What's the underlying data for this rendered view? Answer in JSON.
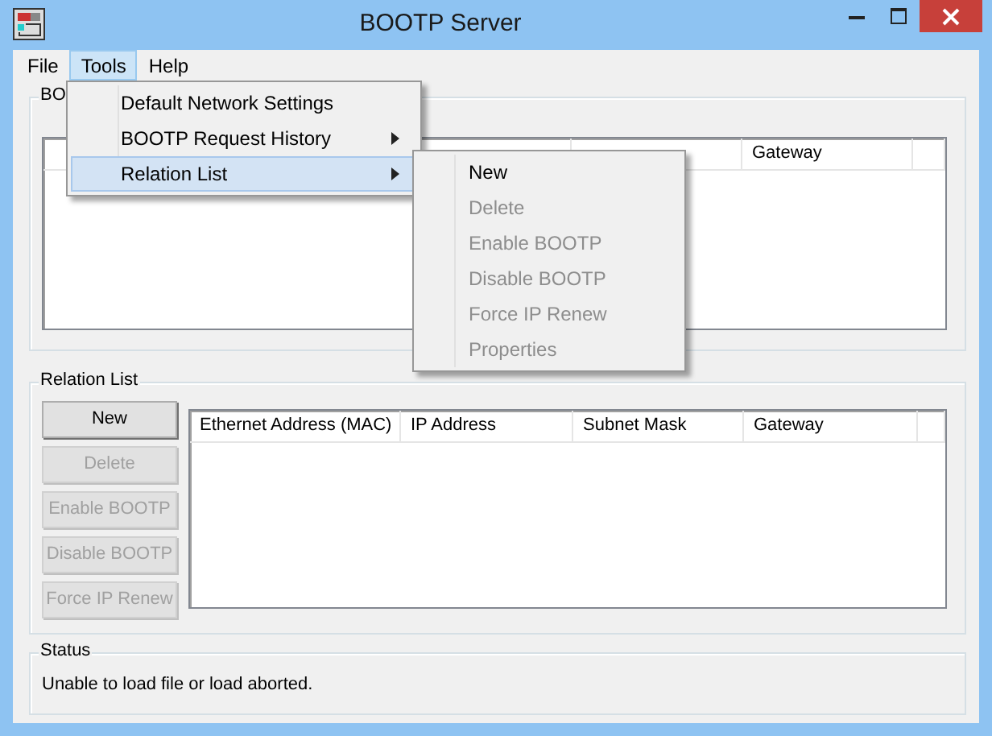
{
  "window": {
    "title": "BOOTP Server"
  },
  "menu_bar": [
    {
      "label": "File",
      "selected": false
    },
    {
      "label": "Tools",
      "selected": true
    },
    {
      "label": "Help",
      "selected": false
    }
  ],
  "tools_menu": [
    {
      "label": "Default Network Settings",
      "has_submenu": false,
      "selected": false
    },
    {
      "label": "BOOTP Request History",
      "has_submenu": true,
      "selected": false
    },
    {
      "label": "Relation List",
      "has_submenu": true,
      "selected": true
    }
  ],
  "relation_submenu": [
    {
      "label": "New",
      "disabled": false
    },
    {
      "label": "Delete",
      "disabled": true
    },
    {
      "label": "Enable BOOTP",
      "disabled": true
    },
    {
      "label": "Disable BOOTP",
      "disabled": true
    },
    {
      "label": "Force IP Renew",
      "disabled": true
    },
    {
      "label": "Properties",
      "disabled": true
    }
  ],
  "top_group": {
    "title": "BO",
    "columns": [
      "Gateway"
    ]
  },
  "relation_list": {
    "title": "Relation List",
    "buttons": [
      {
        "label": "New",
        "disabled": false
      },
      {
        "label": "Delete",
        "disabled": true
      },
      {
        "label": "Enable BOOTP",
        "disabled": true
      },
      {
        "label": "Disable BOOTP",
        "disabled": true
      },
      {
        "label": "Force IP Renew",
        "disabled": true
      }
    ],
    "columns": [
      "Ethernet Address (MAC)",
      "IP Address",
      "Subnet Mask",
      "Gateway"
    ]
  },
  "status": {
    "title": "Status",
    "text": "Unable to load file or load aborted."
  }
}
